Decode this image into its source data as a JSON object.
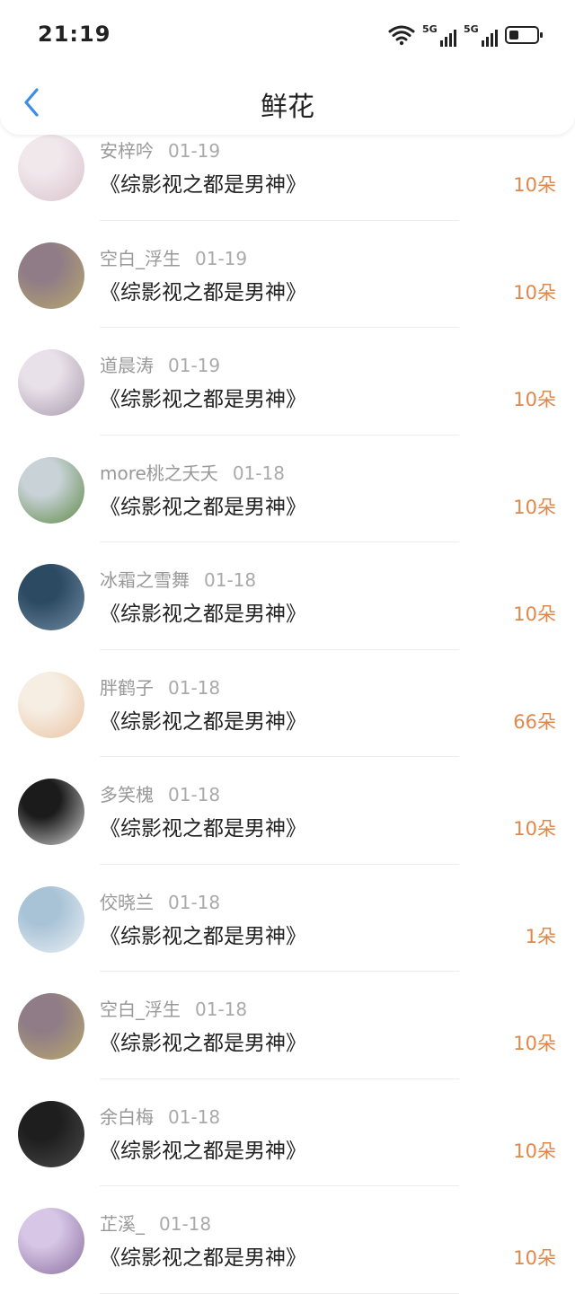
{
  "status_bar": {
    "time": "21:19",
    "sim1": "5G",
    "sim2": "5G",
    "battery_level": 0.35
  },
  "header": {
    "title": "鲜花",
    "back_icon": "chevron-left-icon"
  },
  "colors": {
    "accent_blue": "#3a8ee6",
    "count_orange": "#e0874a"
  },
  "items": [
    {
      "user": "安梓吟",
      "date": "01-19",
      "book": "《综影视之都是男神》",
      "count": "10朵",
      "avatar_colors": [
        "#f1e8ec",
        "#d9c4cc"
      ]
    },
    {
      "user": "空白_浮生",
      "date": "01-19",
      "book": "《综影视之都是男神》",
      "count": "10朵",
      "avatar_colors": [
        "#8f7c87",
        "#b8a86d"
      ]
    },
    {
      "user": "道晨涛",
      "date": "01-19",
      "book": "《综影视之都是男神》",
      "count": "10朵",
      "avatar_colors": [
        "#e9e1ea",
        "#a89aab"
      ]
    },
    {
      "user": "more桃之夭夭",
      "date": "01-18",
      "book": "《综影视之都是男神》",
      "count": "10朵",
      "avatar_colors": [
        "#c8d2d7",
        "#5f8a46"
      ]
    },
    {
      "user": "冰霜之雪舞",
      "date": "01-18",
      "book": "《综影视之都是男神》",
      "count": "10朵",
      "avatar_colors": [
        "#2d4a63",
        "#6e8ba2"
      ]
    },
    {
      "user": "胖鹤子",
      "date": "01-18",
      "book": "《综影视之都是男神》",
      "count": "66朵",
      "avatar_colors": [
        "#f6eee3",
        "#eac3a4"
      ]
    },
    {
      "user": "多笑槐",
      "date": "01-18",
      "book": "《综影视之都是男神》",
      "count": "10朵",
      "avatar_colors": [
        "#1b1b1b",
        "#d0d0d0"
      ]
    },
    {
      "user": "佼晓兰",
      "date": "01-18",
      "book": "《综影视之都是男神》",
      "count": "1朵",
      "avatar_colors": [
        "#a9c3d6",
        "#e9f0f5"
      ]
    },
    {
      "user": "空白_浮生",
      "date": "01-18",
      "book": "《综影视之都是男神》",
      "count": "10朵",
      "avatar_colors": [
        "#8f7c87",
        "#b8a86d"
      ]
    },
    {
      "user": "余白梅",
      "date": "01-18",
      "book": "《综影视之都是男神》",
      "count": "10朵",
      "avatar_colors": [
        "#1e1e1e",
        "#4a4a4a"
      ]
    },
    {
      "user": "芷溪_",
      "date": "01-18",
      "book": "《综影视之都是男神》",
      "count": "10朵",
      "avatar_colors": [
        "#d7c6e6",
        "#8a6f9e"
      ]
    }
  ]
}
